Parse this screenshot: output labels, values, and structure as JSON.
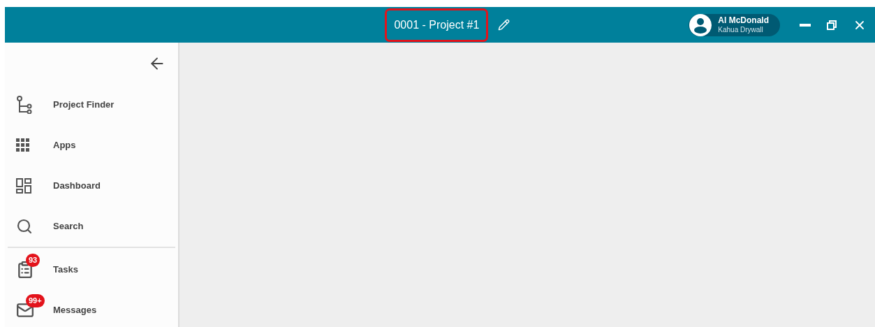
{
  "header": {
    "title": "0001 - Project #1",
    "title_highlighted": true,
    "user": {
      "name": "Al McDonald",
      "company": "Kahua Drywall"
    }
  },
  "sidebar": {
    "sections": [
      {
        "items": [
          {
            "kind": "finder",
            "label": "Project Finder"
          },
          {
            "kind": "apps",
            "label": "Apps"
          },
          {
            "kind": "dashboard",
            "label": "Dashboard"
          },
          {
            "kind": "search",
            "label": "Search"
          }
        ]
      },
      {
        "items": [
          {
            "kind": "tasks",
            "label": "Tasks",
            "badge": "93"
          },
          {
            "kind": "messages",
            "label": "Messages",
            "badge": "99+"
          }
        ]
      }
    ]
  }
}
